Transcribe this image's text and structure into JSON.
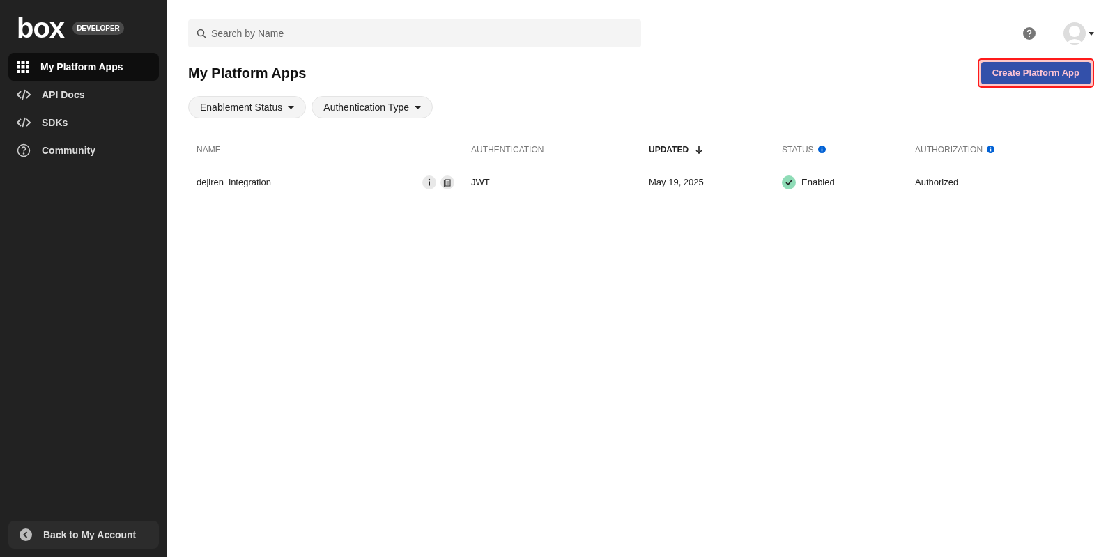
{
  "sidebar": {
    "logo": "box",
    "badge": "DEVELOPER",
    "items": [
      {
        "label": "My Platform Apps",
        "kind": "grid",
        "selected": true
      },
      {
        "label": "API Docs",
        "kind": "code",
        "selected": false
      },
      {
        "label": "SDKs",
        "kind": "code",
        "selected": false
      },
      {
        "label": "Community",
        "kind": "help",
        "selected": false
      }
    ],
    "back_button": "Back to My Account"
  },
  "search": {
    "placeholder": "Search by Name"
  },
  "page_title": "My Platform Apps",
  "create_button": {
    "label": "Create Platform App",
    "highlighted": true
  },
  "filters": [
    "Enablement Status",
    "Authentication Type"
  ],
  "table": {
    "columns": [
      {
        "label": "NAME",
        "sorted": false,
        "info": false
      },
      {
        "label": "AUTHENTICATION",
        "sorted": false,
        "info": false
      },
      {
        "label": "UPDATED",
        "sorted": true,
        "info": false
      },
      {
        "label": "STATUS",
        "sorted": false,
        "info": true
      },
      {
        "label": "AUTHORIZATION",
        "sorted": false,
        "info": true
      }
    ],
    "rows": [
      {
        "name": "dejiren_integration",
        "authentication": "JWT",
        "updated": "May 19, 2025",
        "status": "Enabled",
        "enabled": true,
        "authorization": "Authorized"
      }
    ]
  }
}
